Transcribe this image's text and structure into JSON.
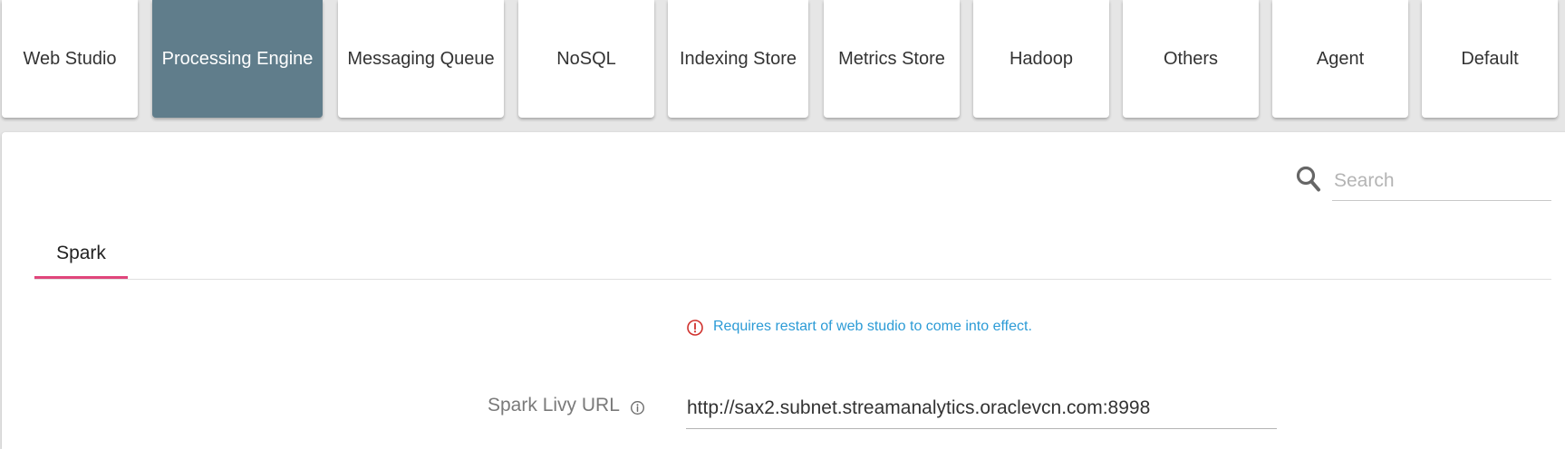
{
  "categories": [
    {
      "label": "Web Studio",
      "active": false
    },
    {
      "label": "Processing Engine",
      "active": true
    },
    {
      "label": "Messaging Queue",
      "active": false
    },
    {
      "label": "NoSQL",
      "active": false
    },
    {
      "label": "Indexing Store",
      "active": false
    },
    {
      "label": "Metrics Store",
      "active": false
    },
    {
      "label": "Hadoop",
      "active": false
    },
    {
      "label": "Others",
      "active": false
    },
    {
      "label": "Agent",
      "active": false
    },
    {
      "label": "Default",
      "active": false
    }
  ],
  "search": {
    "placeholder": "Search",
    "value": "",
    "icon": "search-icon"
  },
  "tabs": [
    {
      "label": "Spark",
      "active": true
    }
  ],
  "notice": {
    "icon": "info-circle-icon",
    "text": "Requires restart of web studio to come into effect."
  },
  "form": {
    "livy": {
      "label": "Spark Livy URL",
      "info_icon": "info-icon",
      "value": "http://sax2.subnet.streamanalytics.oraclevcn.com:8998"
    }
  },
  "colors": {
    "active_tile": "#607d8b",
    "tab_underline": "#e0457b",
    "notice_text": "#2c9bd6",
    "notice_icon": "#d0312d"
  }
}
